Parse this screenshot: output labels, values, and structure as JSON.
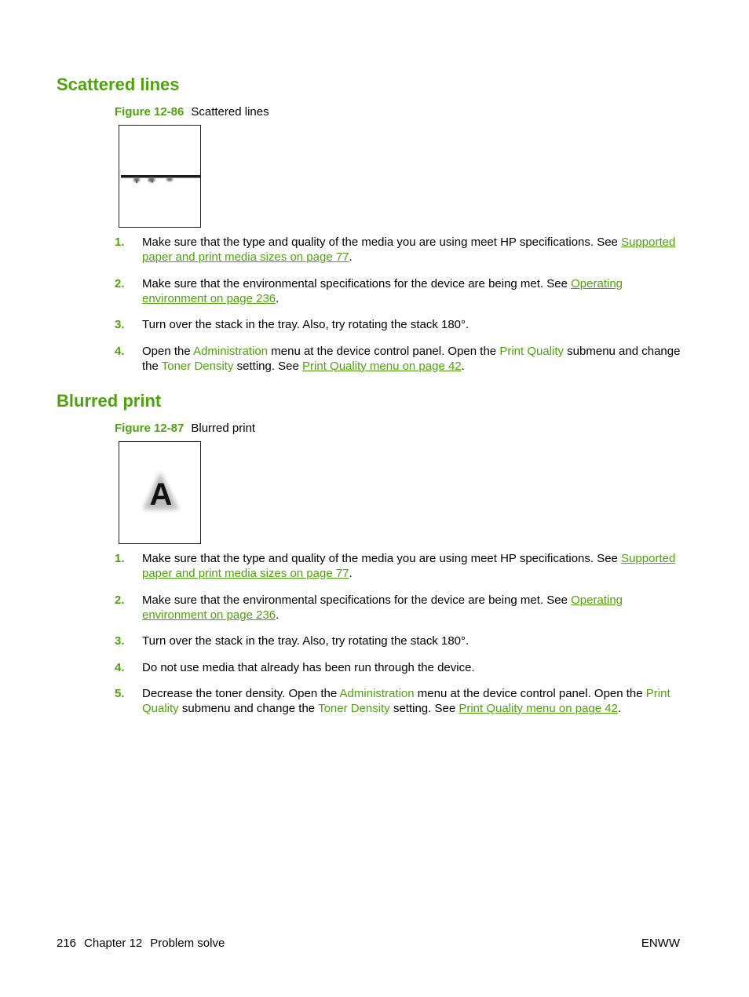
{
  "section1": {
    "heading": "Scattered lines",
    "figure_number": "Figure 12-86",
    "figure_caption": "Scattered lines",
    "figure_icon": "scattered-lines-sample-icon",
    "steps": [
      {
        "num": "1.",
        "text": "Make sure that the type and quality of the media you are using meet HP specifications. See ",
        "link": "Supported paper and print media sizes on page 77",
        "after": "."
      },
      {
        "num": "2.",
        "text": "Make sure that the environmental specifications for the device are being met. See ",
        "link": "Operating environment on page 236",
        "after": "."
      },
      {
        "num": "3.",
        "text": "Turn over the stack in the tray. Also, try rotating the stack 180°."
      },
      {
        "num": "4.",
        "t1": "Open the ",
        "k1": "Administration",
        "t2": " menu at the device control panel. Open the ",
        "k2": "Print Quality",
        "t3": " submenu and change the ",
        "k3": "Toner Density",
        "t4": " setting. See ",
        "link": "Print Quality menu on page 42",
        "after": "."
      }
    ]
  },
  "section2": {
    "heading": "Blurred print",
    "figure_number": "Figure 12-87",
    "figure_caption": "Blurred print",
    "figure_icon": "blurred-print-sample-icon",
    "figure_letter": "A",
    "steps": [
      {
        "num": "1.",
        "text": "Make sure that the type and quality of the media you are using meet HP specifications. See ",
        "link": "Supported paper and print media sizes on page 77",
        "after": "."
      },
      {
        "num": "2.",
        "text": "Make sure that the environmental specifications for the device are being met. See ",
        "link": "Operating environment on page 236",
        "after": "."
      },
      {
        "num": "3.",
        "text": "Turn over the stack in the tray. Also, try rotating the stack 180°."
      },
      {
        "num": "4.",
        "text": "Do not use media that already has been run through the device."
      },
      {
        "num": "5.",
        "t0": "Decrease the toner density. Open the ",
        "k1": "Administration",
        "t2": " menu at the device control panel. Open the ",
        "k2": "Print Quality",
        "t3": " submenu and change the ",
        "k3": "Toner Density",
        "t4": " setting. See ",
        "link": "Print Quality menu on page 42",
        "after": "."
      }
    ]
  },
  "footer": {
    "page_number": "216",
    "chapter": "Chapter 12",
    "chapter_title": "Problem solve",
    "right_label": "ENWW"
  },
  "colors": {
    "accent_green": "#4ea30c",
    "text": "#000000"
  }
}
